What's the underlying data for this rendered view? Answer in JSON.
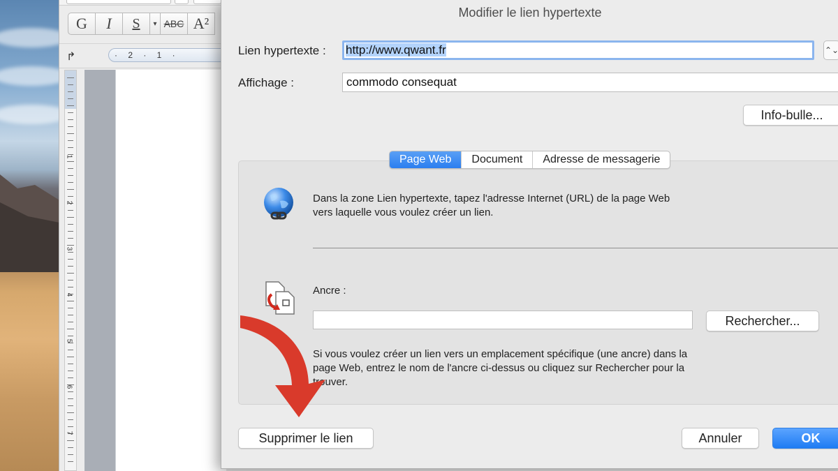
{
  "word": {
    "format_buttons": [
      "G",
      "I",
      "S",
      "▾",
      "ABC",
      "A²"
    ],
    "ruler_numbers": "· 2 · 1 ·",
    "vruler_numbers": [
      "1",
      "2",
      "3",
      "4",
      "5",
      "6",
      "7"
    ],
    "tab_stop_icon": "↱"
  },
  "dialog": {
    "title": "Modifier le lien hypertexte",
    "link_label": "Lien hypertexte :",
    "link_value": "http://www.qwant.fr",
    "stepper_icon": "⌃⌄",
    "display_label": "Affichage :",
    "display_value": "commodo consequat",
    "tooltip_button": "Info-bulle...",
    "tabs": [
      "Page Web",
      "Document",
      "Adresse de messagerie"
    ],
    "active_tab": "Page Web",
    "info_text": "Dans la zone Lien hypertexte, tapez l'adresse Internet (URL) de la page Web vers laquelle vous voulez créer un lien.",
    "anchor_label": "Ancre :",
    "anchor_value": "",
    "search_button": "Rechercher...",
    "anchor_help": "Si vous voulez créer un lien vers un emplacement spécifique (une ancre) dans la page Web, entrez le nom de l'ancre ci-dessus ou cliquez sur Rechercher pour la trouver.",
    "remove_button": "Supprimer le lien",
    "cancel_button": "Annuler",
    "ok_button": "OK"
  },
  "icons": {
    "globe": "globe-link-icon",
    "anchor": "anchor-document-icon",
    "annotation": "red-arrow-annotation"
  },
  "colors": {
    "accent": "#2a7ef0",
    "annotation_arrow": "#d93a2b",
    "dialog_bg": "#ececec"
  }
}
